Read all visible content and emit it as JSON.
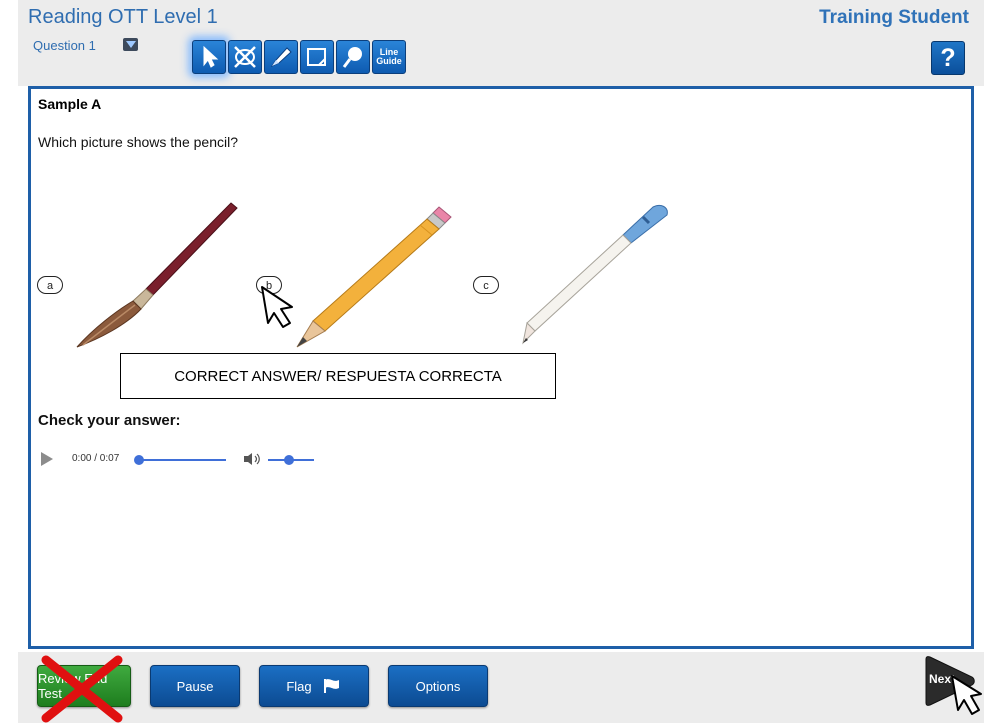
{
  "header": {
    "title": "Reading OTT Level 1",
    "student": "Training Student",
    "question_label": "Question 1",
    "help_label": "?",
    "tools": [
      {
        "name": "pointer",
        "icon": "pointer-arrow-icon",
        "active": true
      },
      {
        "name": "eliminator",
        "icon": "answer-eliminator-icon"
      },
      {
        "name": "highlighter",
        "icon": "highlighter-icon"
      },
      {
        "name": "notepad",
        "icon": "notepad-icon"
      },
      {
        "name": "magnifier",
        "icon": "magnifier-icon"
      },
      {
        "name": "line-guide",
        "label_line1": "Line",
        "label_line2": "Guide"
      }
    ]
  },
  "question": {
    "title": "Sample A",
    "prompt": "Which picture shows the pencil?",
    "choices": [
      {
        "letter": "a",
        "picture": "paintbrush"
      },
      {
        "letter": "b",
        "picture": "pencil"
      },
      {
        "letter": "c",
        "picture": "pen"
      }
    ],
    "answer_callout": "CORRECT ANSWER/ RESPUESTA CORRECTA",
    "check_label": "Check your answer:",
    "audio": {
      "time": "0:00 / 0:07",
      "progress_fraction": 0,
      "volume_fraction": 0.5
    }
  },
  "footer": {
    "review_label": "Review End Test",
    "pause_label": "Pause",
    "flag_label": "Flag",
    "options_label": "Options",
    "next_label": "Next"
  },
  "colors": {
    "title_blue": "#2f6db0",
    "button_blue": "#0e5bb1",
    "frame_border": "#1e5fa8",
    "review_green": "#2e8f2e",
    "cross_red": "#e01010"
  }
}
